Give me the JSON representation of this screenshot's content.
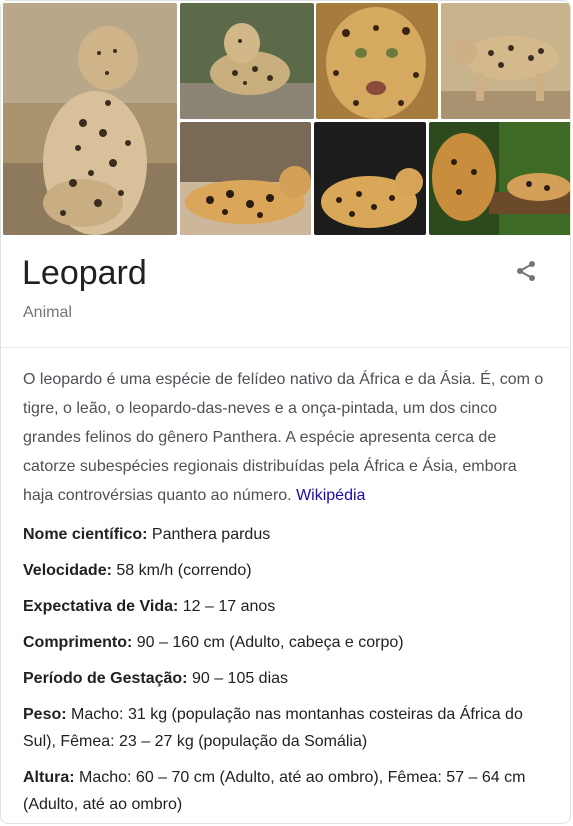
{
  "images": [
    {
      "name": "leopard-photo-sitting",
      "alt": "leopard sitting"
    },
    {
      "name": "leopard-photo-resting-rock",
      "alt": "leopard resting"
    },
    {
      "name": "leopard-photo-face",
      "alt": "leopard face"
    },
    {
      "name": "leopard-photo-walking",
      "alt": "leopard walking"
    },
    {
      "name": "leopard-photo-lying",
      "alt": "leopard lying"
    },
    {
      "name": "leopard-photo-black-bg",
      "alt": "leopard with dark background"
    },
    {
      "name": "leopard-photo-tree",
      "alt": "leopard on tree"
    }
  ],
  "header": {
    "title": "Leopard",
    "subtitle": "Animal",
    "share_icon": "share-icon"
  },
  "description": {
    "text": "O leopardo é uma espécie de felídeo nativo da África e da Ásia. É, com o tigre, o leão, o leopardo-das-neves e a onça-pintada, um dos cinco grandes felinos do gênero Panthera. A espécie apresenta cerca de catorze subespécies regionais distribuídas pela África e Ásia, embora haja controvérsias quanto ao número.",
    "source_link": "Wikipédia"
  },
  "facts": [
    {
      "label": "Nome científico:",
      "value": "Panthera pardus"
    },
    {
      "label": "Velocidade:",
      "value": "58 km/h (correndo)"
    },
    {
      "label": "Expectativa de Vida:",
      "value": "12 – 17 anos"
    },
    {
      "label": "Comprimento:",
      "value": "90 – 160 cm (Adulto, cabeça e corpo)"
    },
    {
      "label": "Período de Gestação:",
      "value": "90 – 105 dias"
    },
    {
      "label": "Peso:",
      "value": "Macho: 31 kg (população nas montanhas costeiras da África do Sul), Fêmea: 23 – 27 kg (população da Somália)"
    },
    {
      "label": "Altura:",
      "value": "Macho: 60 – 70 cm (Adulto, até ao ombro), Fêmea: 57 – 64 cm (Adulto, até ao ombro)"
    }
  ],
  "colors": {
    "link": "#1a0dab",
    "title": "#202124",
    "muted": "#70757a",
    "body": "#4d5156"
  }
}
